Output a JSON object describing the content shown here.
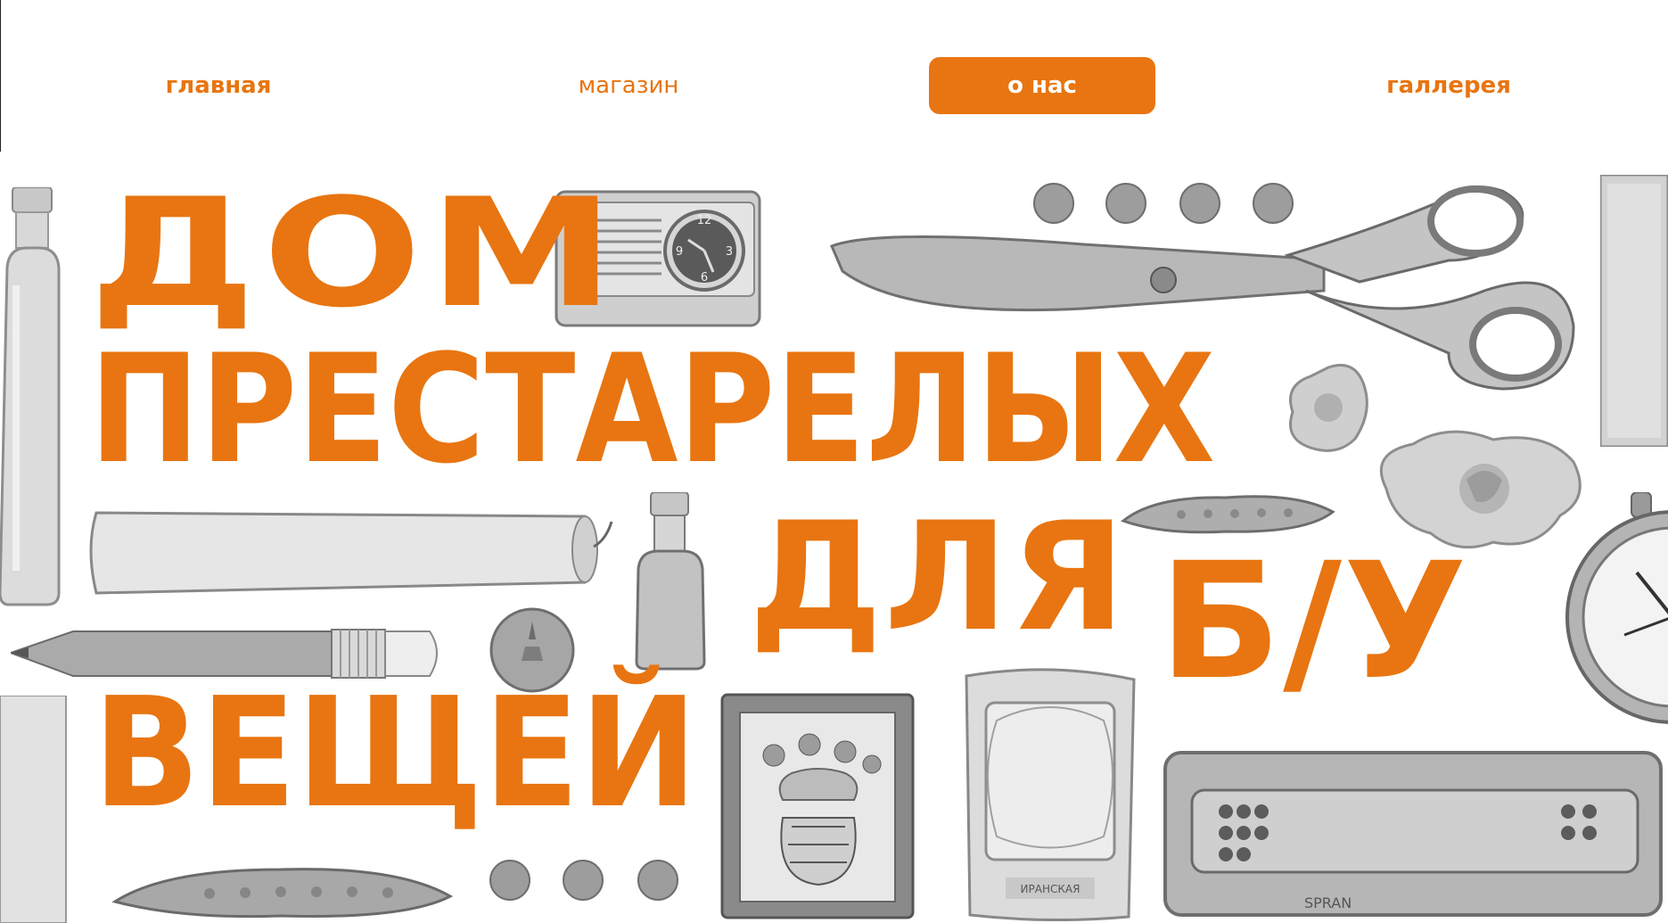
{
  "nav": {
    "items": [
      {
        "id": "home",
        "label": "главная"
      },
      {
        "id": "shop",
        "label": "магазин"
      },
      {
        "id": "about",
        "label": "о нас"
      },
      {
        "id": "gallery",
        "label": "галлерея"
      }
    ],
    "active": "about"
  },
  "headline": {
    "line1": "ДОМ",
    "line2": "ПРЕСТАРЕЛЫХ",
    "line3": "ДЛЯ",
    "line4": "Б/У",
    "line5": "ВЕЩЕЙ"
  },
  "objects": {
    "clock_numbers": [
      "12",
      "9",
      "3",
      "6"
    ],
    "matchbox_label": "ИРАНСКАЯ",
    "harmonica_label": "SPRAN"
  },
  "colors": {
    "accent": "#e87511",
    "background": "#ffffff",
    "object_gray": "#9a9a9a"
  }
}
